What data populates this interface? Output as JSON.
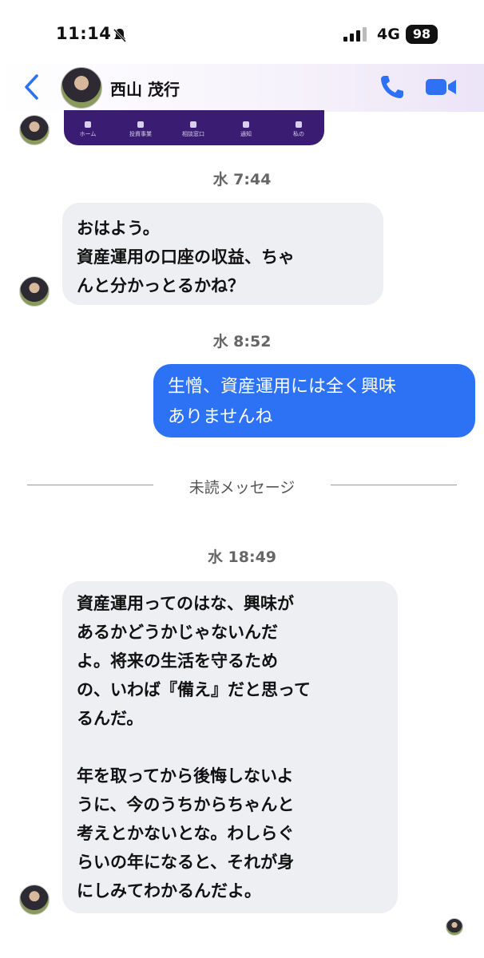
{
  "status": {
    "time": "11:14",
    "network": "4G",
    "battery": "98"
  },
  "header": {
    "contact_name": "西山 茂行"
  },
  "preview_nav": [
    "ホーム",
    "投資事業",
    "相談窓口",
    "通知",
    "私の"
  ],
  "messages": [
    {
      "timestamp": "水 7:44",
      "text": "おはよう。\n資産運用の口座の収益、ちゃ\nんと分かっとるかね？"
    },
    {
      "timestamp": "水 8:52",
      "text": "生憎、資産運用には全く興味\nありませんね"
    },
    {
      "timestamp": "水 18:49",
      "text": "資産運用ってのはな、興味が\nあるかどうかじゃないんだ\nよ。将来の生活を守るため\nの、いわば『備え』だと思って\nるんだ。\n\n年を取ってから後悔しないよ\nうに、今のうちからちゃんと\n考えとかないとな。わしらぐ\nらいの年になると、それが身\nにしみてわかるんだよ。"
    }
  ],
  "unread_label": "未読メッセージ",
  "colors": {
    "accent": "#2d72f5",
    "incoming_bubble": "#eeeff3",
    "preview_card": "#3a1d73"
  }
}
